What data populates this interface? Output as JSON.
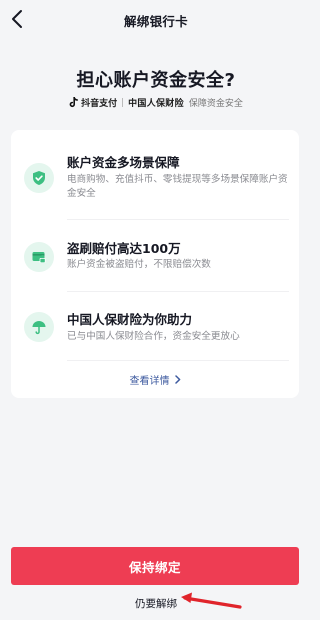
{
  "nav": {
    "title": "解绑银行卡",
    "back_icon": "chevron-left-icon"
  },
  "headline": "担心账户资金安全?",
  "brand": {
    "pay_name": "抖音支付",
    "insurer_name": "中国人保财险",
    "tagline": "保障资金安全"
  },
  "features": [
    {
      "icon": "shield-check-icon",
      "title": "账户资金多场景保障",
      "desc": "电商购物、充值抖币、零钱提现等多场景保障账户资金安全"
    },
    {
      "icon": "card-lock-icon",
      "title": "盗刷赔付高达100万",
      "desc": "账户资金被盗赔付，不限赔偿次数"
    },
    {
      "icon": "umbrella-icon",
      "title": "中国人保财险为你助力",
      "desc": "已与中国人保财险合作，资金安全更放心"
    }
  ],
  "detail_link": "查看详情",
  "primary_button": "保持绑定",
  "secondary_link": "仍要解绑",
  "colors": {
    "primary": "#ee3d53",
    "icon_green": "#3dbf82",
    "icon_bg": "#e4f6ee",
    "link": "#3d5a9f",
    "annotation_arrow": "#e0242b"
  }
}
